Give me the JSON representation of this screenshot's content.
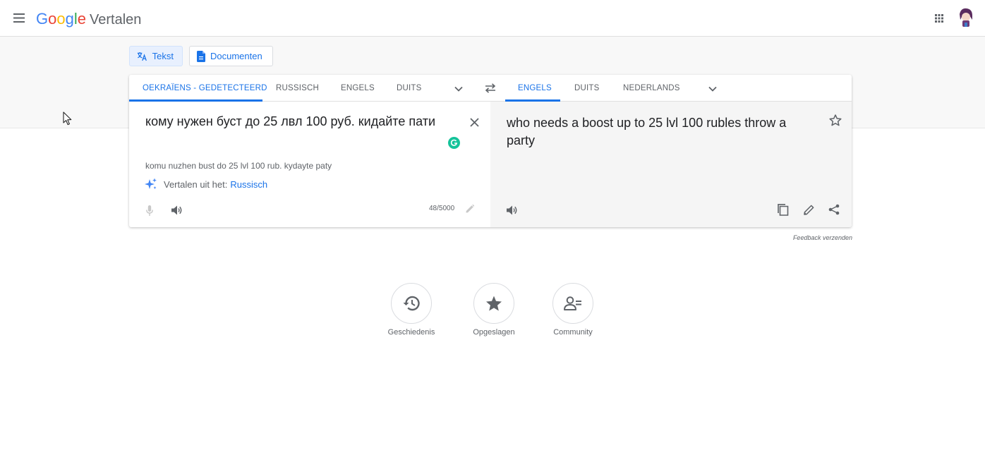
{
  "header": {
    "logo_letters": [
      "G",
      "o",
      "o",
      "g",
      "l",
      "e"
    ],
    "product_name": "Vertalen"
  },
  "modes": {
    "text_label": "Tekst",
    "documents_label": "Documenten"
  },
  "source_langs": {
    "tabs": [
      "OEKRAÏENS - GEDETECTEERD",
      "RUSSISCH",
      "ENGELS",
      "DUITS"
    ],
    "active_index": 0
  },
  "target_langs": {
    "tabs": [
      "ENGELS",
      "DUITS",
      "NEDERLANDS"
    ],
    "active_index": 0
  },
  "source": {
    "text": "кому нужен буст до 25 лвл 100 руб. кидайте пати",
    "transliteration": "komu nuzhen bust do 25 lvl 100 rub. kydayte paty",
    "detect_prefix": "Vertalen uit het:",
    "detect_language": "Russisch",
    "char_count": "48/5000"
  },
  "target": {
    "text": "who needs a boost up to 25 lvl 100 rubles throw a party"
  },
  "feedback_label": "Feedback verzenden",
  "shortcuts": [
    {
      "label": "Geschiedenis",
      "icon": "history-icon"
    },
    {
      "label": "Opgeslagen",
      "icon": "star-icon"
    },
    {
      "label": "Community",
      "icon": "community-icon"
    }
  ],
  "colors": {
    "accent": "#1a73e8",
    "grammarly": "#15c39a"
  }
}
